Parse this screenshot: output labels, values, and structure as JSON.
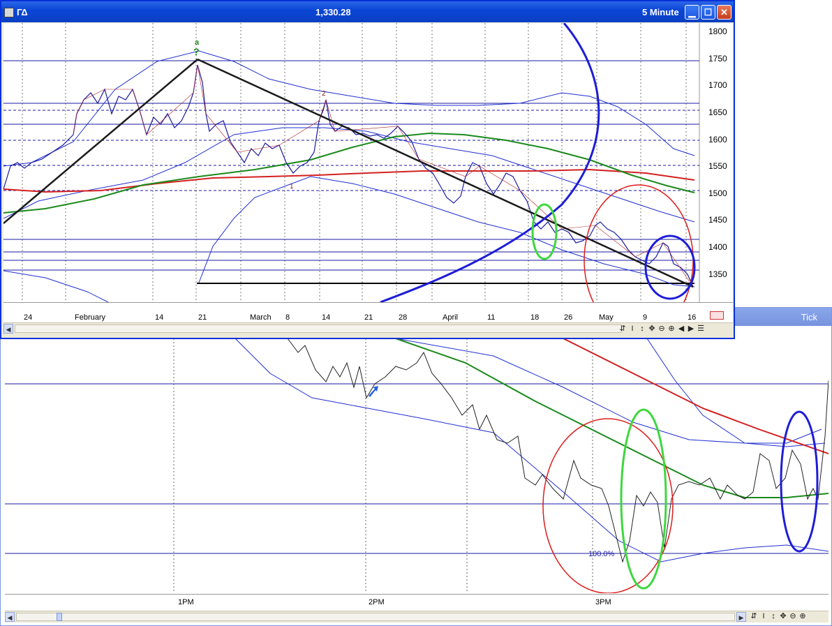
{
  "front_window": {
    "title_symbol": "ΓΔ",
    "title_price": "1,330.28",
    "interval": "5 Minute",
    "y_ticks": [
      "1800",
      "1750",
      "1700",
      "1650",
      "1600",
      "1550",
      "1500",
      "1450",
      "1400",
      "1350"
    ],
    "x_ticks": [
      "24",
      "February",
      "14",
      "21",
      "March",
      "8",
      "14",
      "21",
      "28",
      "April",
      "11",
      "18",
      "26",
      "May",
      "9",
      "16"
    ],
    "wave_labels": {
      "top_letter": "a",
      "top_mark": "?",
      "wave1": "1",
      "wave2": "2"
    },
    "toolbar_icons": [
      "cycle-icon",
      "i-beam-icon",
      "vertical-resize-icon",
      "move-icon",
      "zoom-out-icon",
      "zoom-in-icon",
      "scroll-left-icon",
      "scroll-right-icon",
      "menu-icon"
    ],
    "toolbar_glyphs": [
      "⇵",
      "I",
      "↕",
      "✥",
      "⊖",
      "⊕",
      "◀",
      "▶",
      "☰"
    ]
  },
  "back_window": {
    "title": "Tick",
    "x_ticks": [
      "1PM",
      "2PM",
      "3PM"
    ],
    "fib_label": "100.0%",
    "toolbar_glyphs": [
      "⇵",
      "I",
      "↕",
      "✥",
      "⊖",
      "⊕"
    ]
  },
  "colors": {
    "title_bar": "#0b46d6",
    "grid_line": "#1a1aa0",
    "green_ma": "#1a8a1a",
    "red_ma": "#d42020",
    "blue_band": "#1f2fd0",
    "circle_red": "#dd1c1c",
    "circle_green": "#3ed73e",
    "circle_blue": "#1d1dd8"
  }
}
